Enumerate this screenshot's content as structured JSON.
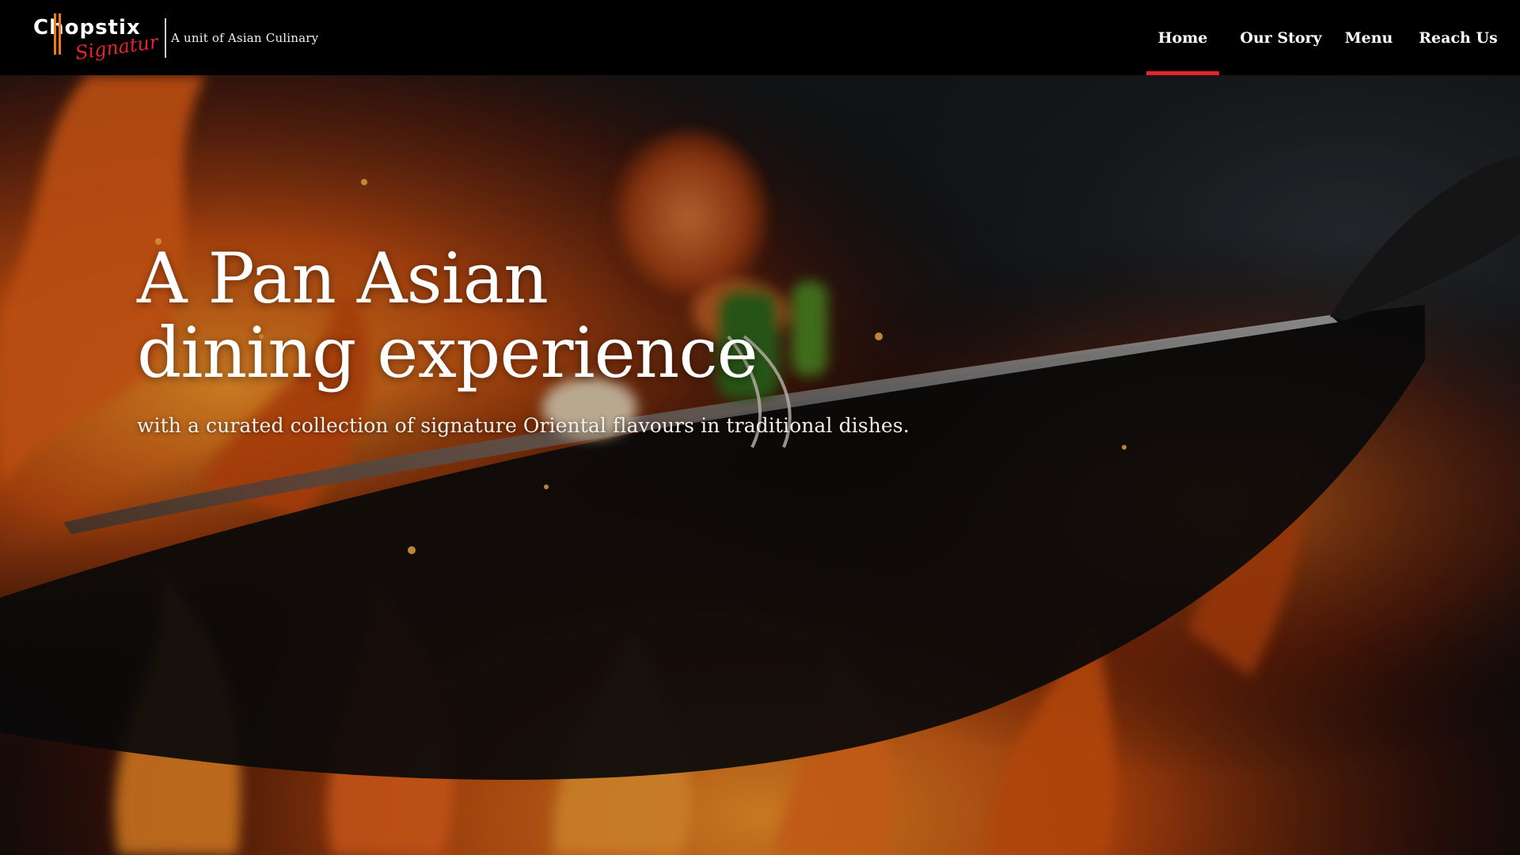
{
  "brand": {
    "logo_text": "Chopstix",
    "logo_script": "Signature",
    "tagline": "A unit of Asian Culinary",
    "logo_colors": {
      "primary": "#ffffff",
      "accent": "#e5252a",
      "bar": "#f07a1a"
    }
  },
  "nav": {
    "items": [
      {
        "label": "Home",
        "active": true
      },
      {
        "label": "Our Story",
        "active": false
      },
      {
        "label": "Menu",
        "active": false
      },
      {
        "label": "Reach Us",
        "active": false
      }
    ],
    "active_color": "#e5252a"
  },
  "hero": {
    "title_line1": "A Pan Asian",
    "title_line2": "dining experience",
    "subtitle": "with a curated collection of signature Oriental flavours in traditional dishes.",
    "background_description_icon": "flaming-wok-image"
  }
}
